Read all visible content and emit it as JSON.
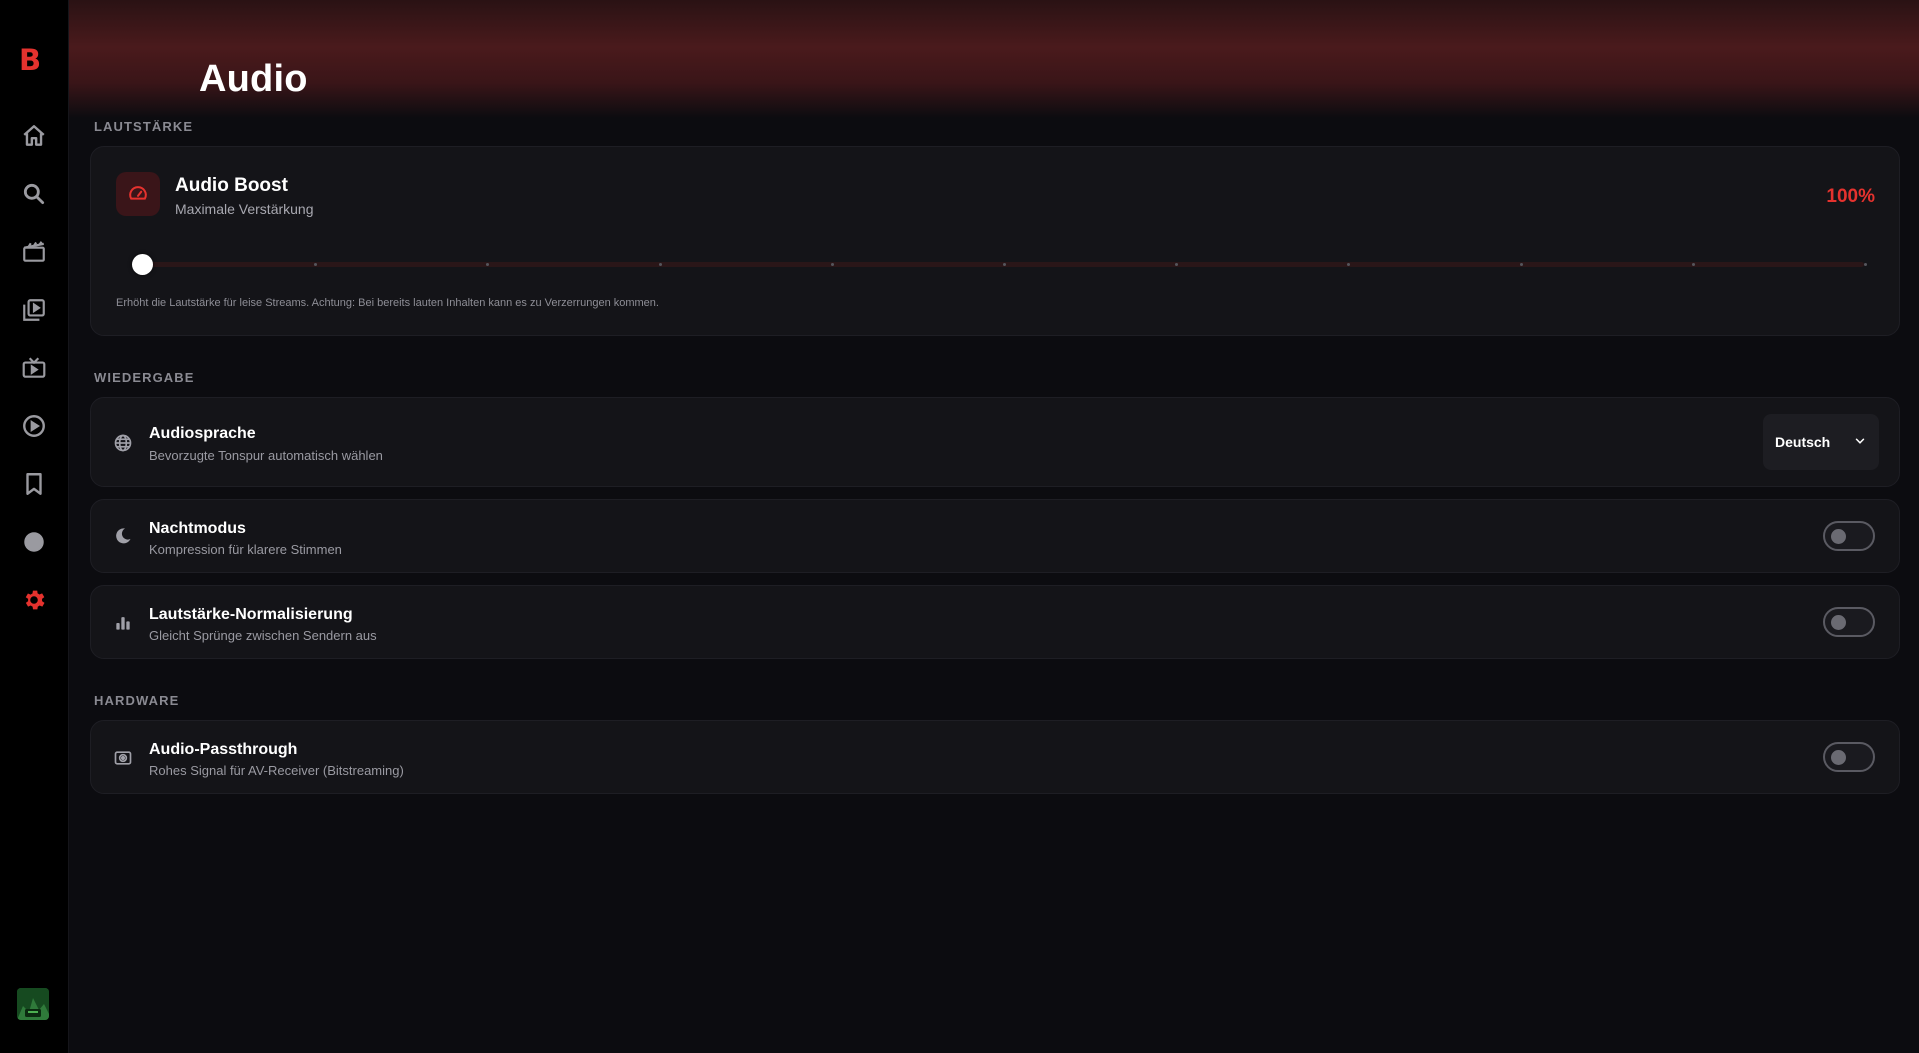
{
  "app": {
    "logo": "B"
  },
  "sidebar": {
    "items": [
      {
        "name": "home",
        "icon": "home-icon"
      },
      {
        "name": "search",
        "icon": "search-icon"
      },
      {
        "name": "movies",
        "icon": "clapperboard-icon"
      },
      {
        "name": "library",
        "icon": "video-library-icon"
      },
      {
        "name": "live-tv",
        "icon": "tv-icon"
      },
      {
        "name": "play",
        "icon": "play-circle-icon"
      },
      {
        "name": "bookmarks",
        "icon": "bookmark-icon"
      },
      {
        "name": "status",
        "icon": "circle-icon"
      },
      {
        "name": "settings",
        "icon": "gear-icon",
        "active": true
      }
    ],
    "accent": "#e5322e",
    "icon_color": "#9a9aa0"
  },
  "header": {
    "title": "Audio"
  },
  "sections": {
    "volume": "LAUTSTÄRKE",
    "playback": "WIEDERGABE",
    "hardware": "HARDWARE"
  },
  "boost": {
    "title": "Audio Boost",
    "subtitle": "Maximale Verstärkung",
    "value_label": "100%",
    "slider_level": 0,
    "slider_ticks": 11,
    "hint": "Erhöht die Lautstärke für leise Streams. Achtung: Bei bereits lauten Inhalten kann es zu Verzerrungen kommen."
  },
  "settings": {
    "language": {
      "title": "Audiosprache",
      "subtitle": "Bevorzugte Tonspur automatisch wählen",
      "selected": "Deutsch"
    },
    "night_mode": {
      "title": "Nachtmodus",
      "subtitle": "Kompression für klarere Stimmen",
      "enabled": false
    },
    "normalization": {
      "title": "Lautstärke-Normalisierung",
      "subtitle": "Gleicht Sprünge zwischen Sendern aus",
      "enabled": false
    },
    "passthrough": {
      "title": "Audio-Passthrough",
      "subtitle": "Rohes Signal für AV-Receiver (Bitstreaming)",
      "enabled": false
    }
  }
}
